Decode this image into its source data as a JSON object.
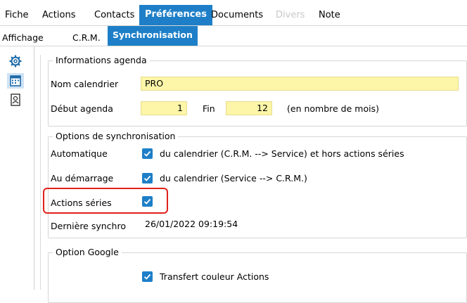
{
  "top_tabs": [
    {
      "label": "Fiche"
    },
    {
      "label": "Actions"
    },
    {
      "label": "Contacts"
    },
    {
      "label": "Préférences"
    },
    {
      "label": "Documents"
    },
    {
      "label": "Divers"
    },
    {
      "label": "Note"
    }
  ],
  "sub_tabs": [
    {
      "label": "Affichage"
    },
    {
      "label": "C.R.M."
    },
    {
      "label": "Synchronisation"
    }
  ],
  "sidebar": {
    "icons": [
      "gear-icon",
      "calendar-icon",
      "contact-card-icon"
    ],
    "selected": "calendar-icon"
  },
  "agenda": {
    "legend": "Informations agenda",
    "nom_label": "Nom calendrier",
    "nom_value": "PRO",
    "debut_label": "Début agenda",
    "debut_value": "1",
    "fin_label": "Fin",
    "fin_value": "12",
    "unit_note": "(en nombre de mois)"
  },
  "sync": {
    "legend": "Options de synchronisation",
    "auto_label": "Automatique",
    "auto_checked": true,
    "auto_text": "du calendrier (C.R.M. --> Service) et hors actions séries",
    "demarrage_label": "Au démarrage",
    "demarrage_checked": true,
    "demarrage_text": "du calendrier (Service --> C.R.M.)",
    "series_label": "Actions séries",
    "series_checked": true,
    "derniere_label": "Dernière synchro",
    "derniere_value": "26/01/2022 09:19:54"
  },
  "google": {
    "legend": "Option Google",
    "transfert_checked": true,
    "transfert_text": "Transfert couleur Actions"
  },
  "colors": {
    "accent": "#1e7fc8",
    "input_bg": "#fdf6a9",
    "highlight": "#e0201a"
  }
}
